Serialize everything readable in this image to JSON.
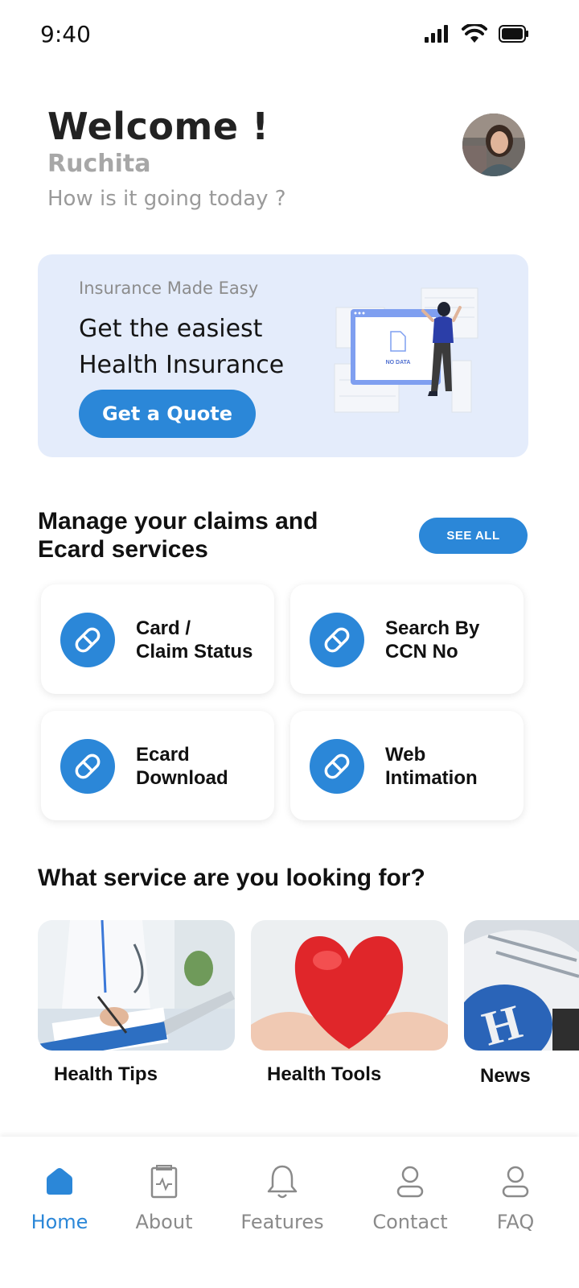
{
  "status_bar": {
    "time": "9:40"
  },
  "header": {
    "welcome": "Welcome !",
    "user_name": "Ruchita",
    "subtitle": "How is it going today ?"
  },
  "banner": {
    "kicker": "Insurance Made Easy",
    "title": "Get the easiest Health Insurance",
    "button_label": "Get a Quote",
    "illustration_text": "NO DATA"
  },
  "claims_section": {
    "title": "Manage your claims and Ecard services",
    "see_all_label": "SEE ALL",
    "cards": [
      {
        "label": "Card /\nClaim Status",
        "icon": "pill-icon"
      },
      {
        "label": "Search By\nCCN No",
        "icon": "pill-icon"
      },
      {
        "label": "Ecard\nDownload",
        "icon": "pill-icon"
      },
      {
        "label": "Web\nIntimation",
        "icon": "pill-icon"
      }
    ]
  },
  "services_section": {
    "title": "What service are you looking for?",
    "items": [
      {
        "label": "Health Tips",
        "image": "doctor-writing-photo"
      },
      {
        "label": "Health Tools",
        "image": "heart-in-hands-photo"
      },
      {
        "label": "News",
        "image": "newspaper-photo"
      }
    ]
  },
  "bottom_nav": {
    "items": [
      {
        "label": "Home",
        "icon": "home-icon",
        "active": true
      },
      {
        "label": "About",
        "icon": "clipboard-pulse-icon",
        "active": false
      },
      {
        "label": "Features",
        "icon": "bell-icon",
        "active": false
      },
      {
        "label": "Contact",
        "icon": "user-icon",
        "active": false
      },
      {
        "label": "FAQ",
        "icon": "user-icon",
        "active": false
      }
    ]
  },
  "colors": {
    "accent": "#2b87d8",
    "banner_bg": "#e4ecfb",
    "muted_text": "#9a9a9a"
  }
}
